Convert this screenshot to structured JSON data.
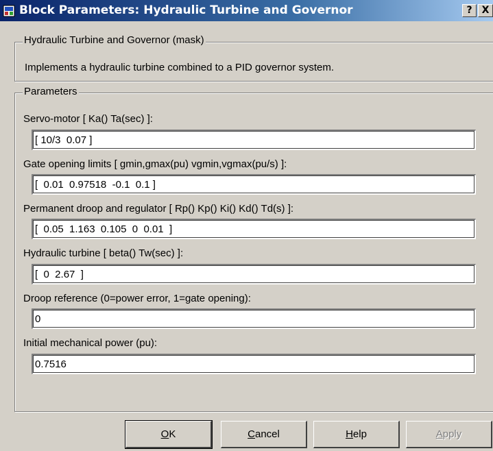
{
  "window": {
    "title": "Block Parameters: Hydraulic Turbine and Governor",
    "help_glyph": "?",
    "close_glyph": "X"
  },
  "description_group": {
    "legend": "Hydraulic Turbine and Governor (mask)",
    "text": "Implements a hydraulic turbine combined to a PID governor system."
  },
  "parameters_group": {
    "legend": "Parameters",
    "fields": [
      {
        "label": "Servo-motor [ Ka()  Ta(sec) ]:",
        "value": "[ 10/3  0.07 ]"
      },
      {
        "label": "Gate opening limits [ gmin,gmax(pu)    vgmin,vgmax(pu/s) ]:",
        "value": "[  0.01  0.97518  -0.1  0.1 ]"
      },
      {
        "label": "Permanent droop and regulator  [ Rp() Kp() Ki() Kd() Td(s) ]:",
        "value": "[  0.05  1.163  0.105  0  0.01  ]"
      },
      {
        "label": "Hydraulic turbine [ beta()  Tw(sec) ]:",
        "value": "[  0  2.67  ]"
      },
      {
        "label": "Droop reference (0=power error, 1=gate opening):",
        "value": "0"
      },
      {
        "label": "Initial mechanical power (pu):",
        "value": "0.7516"
      }
    ]
  },
  "buttons": {
    "ok_mnemonic": "O",
    "ok_rest": "K",
    "cancel_mnemonic": "C",
    "cancel_rest": "ancel",
    "help_mnemonic": "H",
    "help_rest": "elp",
    "apply_mnemonic": "A",
    "apply_rest": "pply"
  },
  "colors": {
    "dialog_bg": "#d4d0c8",
    "titlebar_start": "#0a246a",
    "titlebar_end": "#a6caf0"
  },
  "icons": {
    "app": "simulink-block-icon",
    "help": "question-mark-icon",
    "close": "close-icon"
  }
}
